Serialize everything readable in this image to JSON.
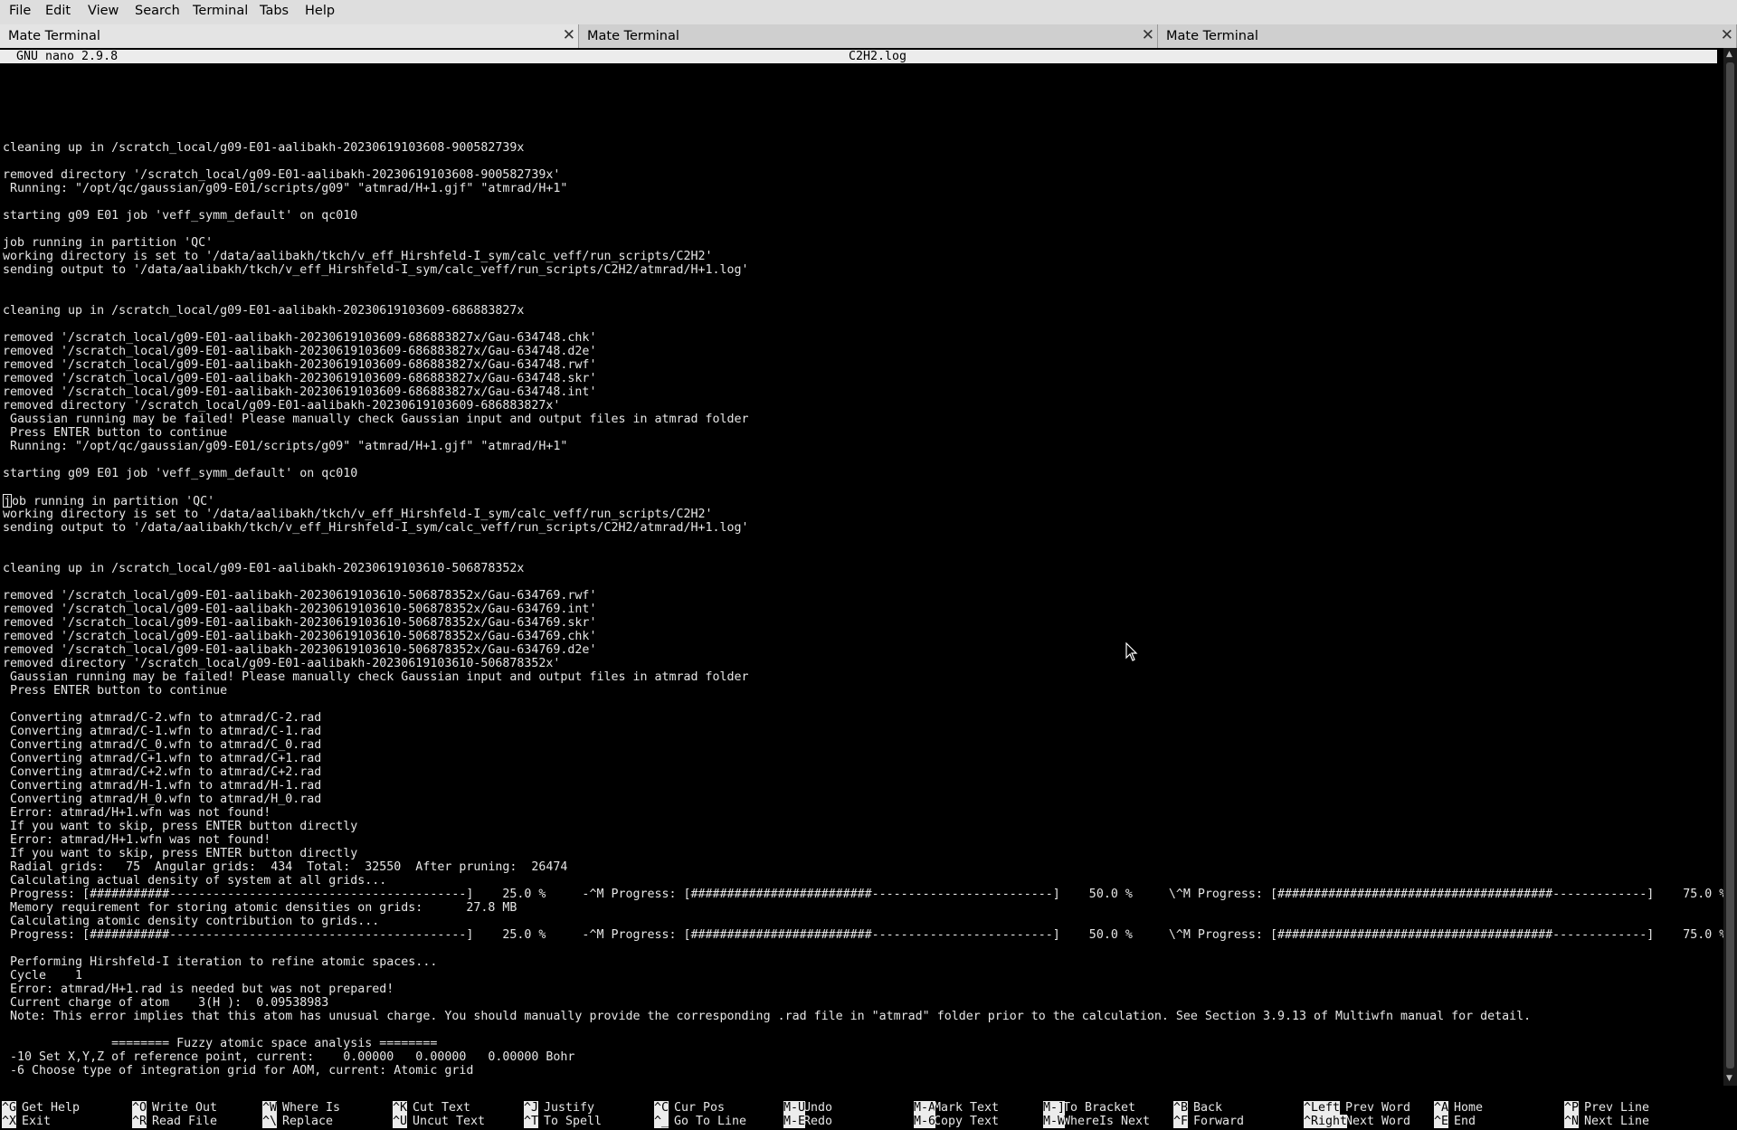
{
  "menubar": {
    "items": [
      "File",
      "Edit",
      "View",
      "Search",
      "Terminal",
      "Tabs",
      "Help"
    ]
  },
  "tabs": [
    {
      "label": "Mate Terminal",
      "close": "✕"
    },
    {
      "label": "Mate Terminal",
      "close": "✕"
    },
    {
      "label": "Mate Terminal",
      "close": "✕"
    }
  ],
  "nano": {
    "version": "GNU nano 2.9.8",
    "filename": "C2H2.log"
  },
  "terminal_lines": [
    "",
    "",
    "",
    "cleaning up in /scratch_local/g09-E01-aalibakh-20230619103608-900582739x",
    "",
    "removed directory '/scratch_local/g09-E01-aalibakh-20230619103608-900582739x'",
    " Running: \"/opt/qc/gaussian/g09-E01/scripts/g09\" \"atmrad/H+1.gjf\" \"atmrad/H+1\"",
    "",
    "starting g09 E01 job 'veff_symm_default' on qc010",
    "",
    "job running in partition 'QC'",
    "working directory is set to '/data/aalibakh/tkch/v_eff_Hirshfeld-I_sym/calc_veff/run_scripts/C2H2'",
    "sending output to '/data/aalibakh/tkch/v_eff_Hirshfeld-I_sym/calc_veff/run_scripts/C2H2/atmrad/H+1.log'",
    "",
    "",
    "cleaning up in /scratch_local/g09-E01-aalibakh-20230619103609-686883827x",
    "",
    "removed '/scratch_local/g09-E01-aalibakh-20230619103609-686883827x/Gau-634748.chk'",
    "removed '/scratch_local/g09-E01-aalibakh-20230619103609-686883827x/Gau-634748.d2e'",
    "removed '/scratch_local/g09-E01-aalibakh-20230619103609-686883827x/Gau-634748.rwf'",
    "removed '/scratch_local/g09-E01-aalibakh-20230619103609-686883827x/Gau-634748.skr'",
    "removed '/scratch_local/g09-E01-aalibakh-20230619103609-686883827x/Gau-634748.int'",
    "removed directory '/scratch_local/g09-E01-aalibakh-20230619103609-686883827x'",
    " Gaussian running may be failed! Please manually check Gaussian input and output files in atmrad folder",
    " Press ENTER button to continue",
    " Running: \"/opt/qc/gaussian/g09-E01/scripts/g09\" \"atmrad/H+1.gjf\" \"atmrad/H+1\"",
    "",
    "starting g09 E01 job 'veff_symm_default' on qc010",
    "",
    "ob running in partition 'QC'",
    "working directory is set to '/data/aalibakh/tkch/v_eff_Hirshfeld-I_sym/calc_veff/run_scripts/C2H2'",
    "sending output to '/data/aalibakh/tkch/v_eff_Hirshfeld-I_sym/calc_veff/run_scripts/C2H2/atmrad/H+1.log'",
    "",
    "",
    "cleaning up in /scratch_local/g09-E01-aalibakh-20230619103610-506878352x",
    "",
    "removed '/scratch_local/g09-E01-aalibakh-20230619103610-506878352x/Gau-634769.rwf'",
    "removed '/scratch_local/g09-E01-aalibakh-20230619103610-506878352x/Gau-634769.int'",
    "removed '/scratch_local/g09-E01-aalibakh-20230619103610-506878352x/Gau-634769.skr'",
    "removed '/scratch_local/g09-E01-aalibakh-20230619103610-506878352x/Gau-634769.chk'",
    "removed '/scratch_local/g09-E01-aalibakh-20230619103610-506878352x/Gau-634769.d2e'",
    "removed directory '/scratch_local/g09-E01-aalibakh-20230619103610-506878352x'",
    " Gaussian running may be failed! Please manually check Gaussian input and output files in atmrad folder",
    " Press ENTER button to continue",
    "",
    " Converting atmrad/C-2.wfn to atmrad/C-2.rad",
    " Converting atmrad/C-1.wfn to atmrad/C-1.rad",
    " Converting atmrad/C_0.wfn to atmrad/C_0.rad",
    " Converting atmrad/C+1.wfn to atmrad/C+1.rad",
    " Converting atmrad/C+2.wfn to atmrad/C+2.rad",
    " Converting atmrad/H-1.wfn to atmrad/H-1.rad",
    " Converting atmrad/H_0.wfn to atmrad/H_0.rad",
    " Error: atmrad/H+1.wfn was not found!",
    " If you want to skip, press ENTER button directly",
    " Error: atmrad/H+1.wfn was not found!",
    " If you want to skip, press ENTER button directly",
    " Radial grids:   75  Angular grids:  434  Total:  32550  After pruning:  26474",
    " Calculating actual density of system at all grids...",
    " Progress: [###########-----------------------------------------]    25.0 %     -^M Progress: [#########################-------------------------]    50.0 %     \\^M Progress: [######################################-------------]    75.0 % $",
    " Memory requirement for storing atomic densities on grids:      27.8 MB",
    " Calculating atomic density contribution to grids...",
    " Progress: [###########-----------------------------------------]    25.0 %     -^M Progress: [#########################-------------------------]    50.0 %     \\^M Progress: [######################################-------------]    75.0 % $",
    "",
    " Performing Hirshfeld-I iteration to refine atomic spaces...",
    " Cycle    1",
    " Error: atmrad/H+1.rad is needed but was not prepared!",
    " Current charge of atom    3(H ):  0.09538983",
    " Note: This error implies that this atom has unusual charge. You should manually provide the corresponding .rad file in \"atmrad\" folder prior to the calculation. See Section 3.9.13 of Multiwfn manual for detail.",
    "",
    "               ======== Fuzzy atomic space analysis ========",
    " -10 Set X,Y,Z of reference point, current:    0.00000   0.00000   0.00000 Bohr",
    " -6 Choose type of integration grid for AOM, current: Atomic grid"
  ],
  "cursor_char": "j",
  "help": [
    [
      {
        "key": "^G",
        "label": "Get Help"
      },
      {
        "key": "^X",
        "label": "Exit"
      }
    ],
    [
      {
        "key": "^O",
        "label": "Write Out"
      },
      {
        "key": "^R",
        "label": "Read File"
      }
    ],
    [
      {
        "key": "^W",
        "label": "Where Is"
      },
      {
        "key": "^\\",
        "label": "Replace"
      }
    ],
    [
      {
        "key": "^K",
        "label": "Cut Text"
      },
      {
        "key": "^U",
        "label": "Uncut Text"
      }
    ],
    [
      {
        "key": "^J",
        "label": "Justify"
      },
      {
        "key": "^T",
        "label": "To Spell"
      }
    ],
    [
      {
        "key": "^C",
        "label": "Cur Pos"
      },
      {
        "key": "^_",
        "label": "Go To Line"
      }
    ],
    [
      {
        "key": "M-U",
        "label": "Undo"
      },
      {
        "key": "M-E",
        "label": "Redo"
      }
    ],
    [
      {
        "key": "M-A",
        "label": "Mark Text"
      },
      {
        "key": "M-6",
        "label": "Copy Text"
      }
    ],
    [
      {
        "key": "M-]",
        "label": "To Bracket"
      },
      {
        "key": "M-W",
        "label": "WhereIs Next"
      }
    ],
    [
      {
        "key": "^B",
        "label": "Back"
      },
      {
        "key": "^F",
        "label": "Forward"
      }
    ],
    [
      {
        "key": "^Left",
        "label": "Prev Word"
      },
      {
        "key": "^Right",
        "label": "Next Word"
      }
    ],
    [
      {
        "key": "^A",
        "label": "Home"
      },
      {
        "key": "^E",
        "label": "End"
      }
    ],
    [
      {
        "key": "^P",
        "label": "Prev Line"
      },
      {
        "key": "^N",
        "label": "Next Line"
      }
    ]
  ]
}
